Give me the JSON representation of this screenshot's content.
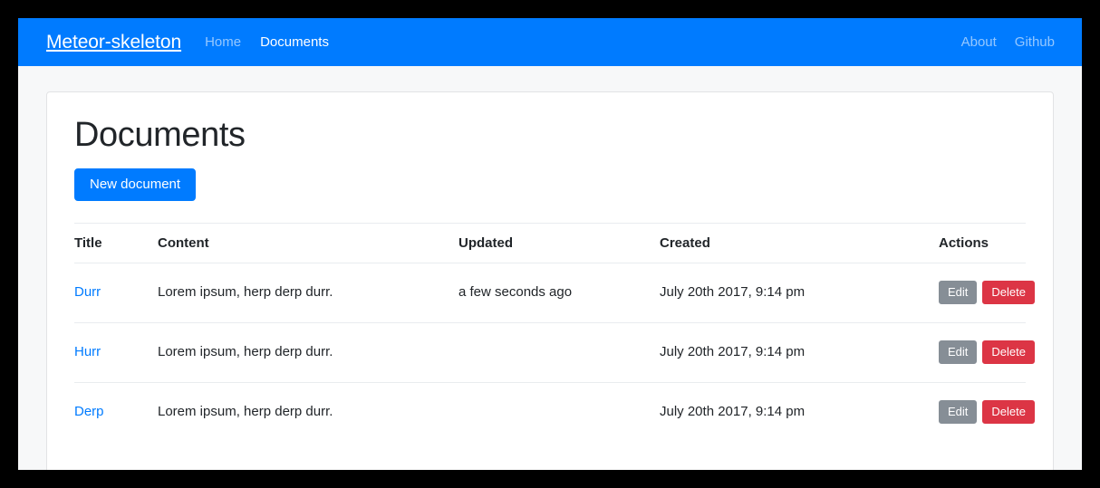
{
  "navbar": {
    "brand": "Meteor-skeleton",
    "left_links": [
      {
        "label": "Home",
        "state": "muted"
      },
      {
        "label": "Documents",
        "state": "active"
      }
    ],
    "right_links": [
      {
        "label": "About"
      },
      {
        "label": "Github"
      }
    ],
    "background_color": "#007bff"
  },
  "main": {
    "title": "Documents",
    "new_document_label": "New document",
    "table": {
      "headers": {
        "title": "Title",
        "content": "Content",
        "updated": "Updated",
        "created": "Created",
        "actions": "Actions"
      },
      "rows": [
        {
          "title": "Durr",
          "content": "Lorem ipsum, herp derp durr.",
          "updated": "a few seconds ago",
          "created": "July 20th 2017, 9:14 pm",
          "edit_label": "Edit",
          "delete_label": "Delete"
        },
        {
          "title": "Hurr",
          "content": "Lorem ipsum, herp derp durr.",
          "updated": "",
          "created": "July 20th 2017, 9:14 pm",
          "edit_label": "Edit",
          "delete_label": "Delete"
        },
        {
          "title": "Derp",
          "content": "Lorem ipsum, herp derp durr.",
          "updated": "",
          "created": "July 20th 2017, 9:14 pm",
          "edit_label": "Edit",
          "delete_label": "Delete"
        }
      ]
    }
  },
  "colors": {
    "primary": "#007bff",
    "secondary": "#868e96",
    "danger": "#dc3545",
    "link": "#007bff",
    "page_background": "#f7f8f9",
    "card_background": "#ffffff"
  }
}
